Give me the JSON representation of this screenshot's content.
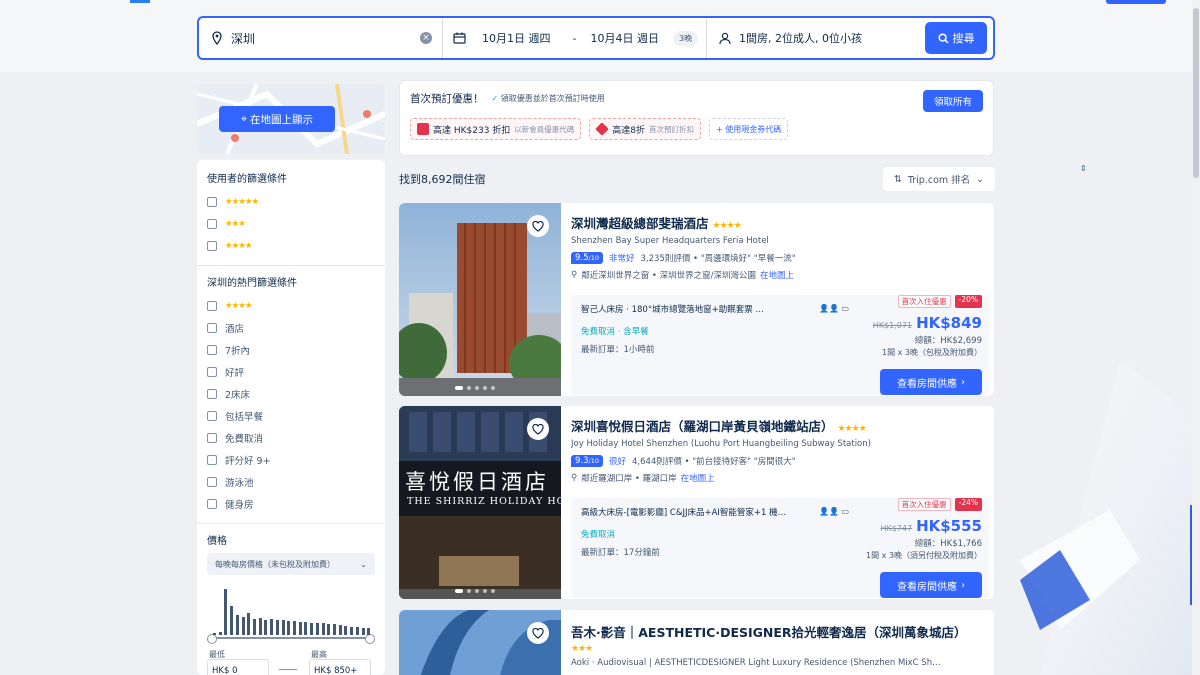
{
  "search": {
    "destination": "深圳",
    "checkin": "10月1日 週四",
    "checkout": "10月4日 週日",
    "dash": "-",
    "nights": "3晚",
    "guests": "1間房, 2位成人, 0位小孩",
    "button": "搜尋"
  },
  "map": {
    "button": "在地圖上顯示"
  },
  "filters": {
    "popular_title": "使用者的篩選條件",
    "popular": [
      {
        "stars": "★★★★★"
      },
      {
        "stars": "★★★"
      },
      {
        "stars": "★★★★"
      }
    ],
    "hot_title": "深圳的熱門篩選條件",
    "hot": [
      {
        "label": "",
        "stars": "★★★★"
      },
      {
        "label": "酒店",
        "stars": ""
      },
      {
        "label": "7折內",
        "stars": ""
      },
      {
        "label": "好評",
        "stars": ""
      },
      {
        "label": "2床床",
        "stars": ""
      },
      {
        "label": "包括早餐",
        "stars": ""
      },
      {
        "label": "免費取消",
        "stars": ""
      },
      {
        "label": "評分好 9+",
        "stars": ""
      },
      {
        "label": "游泳池",
        "stars": ""
      },
      {
        "label": "健身房",
        "stars": ""
      }
    ],
    "price_title": "價格",
    "price_mode": "每晚每房價格（未包稅及附加費）",
    "min_label": "最低",
    "max_label": "最高",
    "min_value": "HK$ 0",
    "max_value": "HK$ 850+",
    "histogram": [
      2,
      3,
      45,
      28,
      20,
      18,
      22,
      16,
      17,
      15,
      16,
      15,
      15,
      14,
      14,
      13,
      13,
      12,
      12,
      12,
      11,
      11,
      10,
      9,
      8,
      8,
      7,
      7
    ]
  },
  "promo": {
    "title": "首次預訂優惠！",
    "subtitle": "領取優惠並於首次預訂時使用",
    "claim": "領取所有",
    "coupons": [
      {
        "amount": "高達 HK$233 折扣",
        "desc": "以新會員優惠代碼"
      },
      {
        "amount": "高達8折",
        "desc": "首次預訂折扣"
      },
      {
        "amount": "",
        "desc": "使用現金券代碼"
      }
    ],
    "more_label": "+ 使用現金券代碼"
  },
  "results": {
    "count": "找到8,692間住宿",
    "sort": "Trip.com 排名"
  },
  "hotels": [
    {
      "name": "深圳灣超級總部斐瑞酒店",
      "stars": "★★★★",
      "name_en": "Shenzhen Bay Super Headquarters Feria Hotel",
      "score": "9.5",
      "score_max": "/10",
      "rating_word": "非常好",
      "reviews": "3,235則評價 • \"周邊環境好\" \"早餐一流\"",
      "location": "鄰近深圳世界之窗 • 深圳世界之窗/深圳灣公園",
      "map_link": "在地圖上",
      "room": "智己人床房 · 180°城市總覽落地窗+助眠套票 …",
      "free_cancel": "免費取消 · 含早餐",
      "last_booked": "最新訂單：1小時前",
      "badge_a": "首次入住優惠",
      "badge_b": "-20%",
      "old_price": "HK$1,071",
      "price": "HK$849",
      "tax": "總額：HK$2,699",
      "nights_info": "1間 x 3晚（包稅及附加費）",
      "cta": "查看房間供應"
    },
    {
      "name": "深圳喜悅假日酒店（羅湖口岸黃貝嶺地鐵站店）",
      "stars": "★★★★",
      "name_en": "Joy Holiday Hotel Shenzhen (Luohu Port Huangbeiling Subway Station)",
      "score": "9.3",
      "score_max": "/10",
      "rating_word": "很好",
      "reviews": "4,644則評價 • \"前台接待好客\" \"房間很大\"",
      "location": "鄰近羅湖口岸 • 羅湖口岸",
      "map_link": "在地圖上",
      "room": "高級大床房-[電影影廳] C&JJ床品+AI智能管家+1 機…",
      "free_cancel": "免費取消",
      "last_booked": "最新訂單：17分鐘前",
      "badge_a": "首次入住優惠",
      "badge_b": "-24%",
      "old_price": "HK$747",
      "price": "HK$555",
      "tax": "總額：HK$1,766",
      "nights_info": "1間 x 3晚（須另付稅及附加費）",
      "cta": "查看房間供應"
    }
  ],
  "hotel3": {
    "name": "吾木·影音｜AESTHETIC·DESIGNER拾光輕奢逸居（深圳萬象城店）",
    "stars": "★★★",
    "name_en": "Aoki · Audiovisual | AESTHETICDESIGNER Light Luxury Residence (Shenzhen MixC Sh…"
  },
  "sign_text": "喜悅假日酒店",
  "sign_en": "THE SHIRRIZ HOLIDAY HO",
  "colors": {
    "accent": "#3264ff",
    "star": "#ffb400",
    "discount": "#e6334d"
  }
}
